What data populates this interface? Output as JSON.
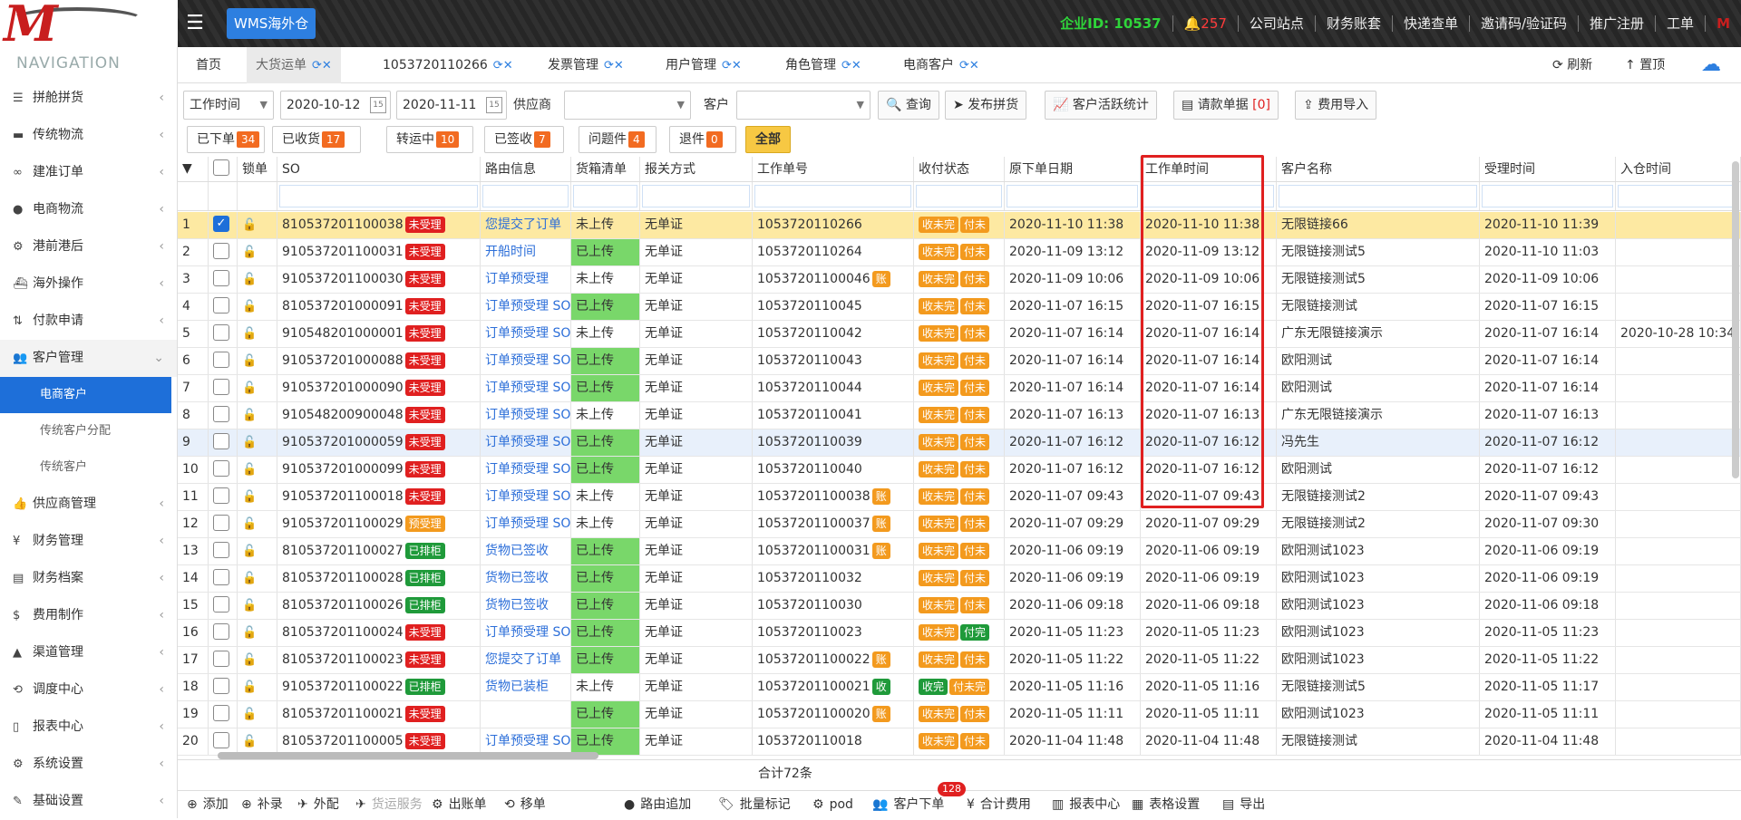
{
  "app": {
    "wms_button": "WMS海外仓",
    "nav_title": "NAVIGATION"
  },
  "top": {
    "ent_id": "企业ID:  10537",
    "bell_count": "257",
    "links": [
      "公司站点",
      "财务账套",
      "快递查单",
      "邀请码/验证码",
      "推广注册",
      "工单"
    ]
  },
  "sidebar": {
    "items": [
      {
        "label": "拼舱拼货",
        "icon": "list-icon"
      },
      {
        "label": "传统物流",
        "icon": "truck-icon"
      },
      {
        "label": "建准订单",
        "icon": "link-icon"
      },
      {
        "label": "电商物流",
        "icon": "globe-icon"
      },
      {
        "label": "港前港后",
        "icon": "gears-icon"
      },
      {
        "label": "海外操作",
        "icon": "ship-icon"
      },
      {
        "label": "付款申请",
        "icon": "sort-icon"
      },
      {
        "label": "客户管理",
        "icon": "users-icon"
      }
    ],
    "sub": [
      "电商客户",
      "传统客户分配",
      "传统客户"
    ],
    "items2": [
      {
        "label": "供应商管理",
        "icon": "thumb-icon"
      },
      {
        "label": "财务管理",
        "icon": "yen-icon"
      },
      {
        "label": "财务档案",
        "icon": "book-icon"
      },
      {
        "label": "费用制作",
        "icon": "dollar-icon"
      },
      {
        "label": "渠道管理",
        "icon": "road-icon"
      },
      {
        "label": "调度中心",
        "icon": "retweet-icon"
      },
      {
        "label": "报表中心",
        "icon": "file-icon"
      },
      {
        "label": "系统设置",
        "icon": "gear-icon"
      },
      {
        "label": "基础设置",
        "icon": "pencil-icon"
      }
    ]
  },
  "tabs": [
    {
      "label": "首页"
    },
    {
      "label": "大货运单"
    },
    {
      "label": "1053720110266"
    },
    {
      "label": "发票管理"
    },
    {
      "label": "用户管理"
    },
    {
      "label": "角色管理"
    },
    {
      "label": "电商客户"
    }
  ],
  "tab_actions": {
    "refresh": "刷新",
    "top": "置顶"
  },
  "filters": {
    "time_type": "工作时间",
    "date_from": "2020-10-12",
    "date_to": "2020-11-11",
    "supplier_label": "供应商",
    "customer_label": "客户",
    "query": "查询",
    "publish": "发布拼货",
    "stats": "客户活跃统计",
    "invoice": "请款单据",
    "invoice_count": "[0]",
    "fee_import": "费用导入"
  },
  "status_buttons": [
    {
      "label": "已下单",
      "count": "34"
    },
    {
      "label": "已收货",
      "count": "17"
    },
    {
      "label": "转运中",
      "count": "10"
    },
    {
      "label": "已签收",
      "count": "7"
    },
    {
      "label": "问题件",
      "count": "4"
    },
    {
      "label": "退件",
      "count": "0"
    }
  ],
  "status_all": "全部",
  "columns": [
    "锁单",
    "SO",
    "路由信息",
    "货箱清单",
    "报关方式",
    "工作单号",
    "收付状态",
    "原下单日期",
    "工作单时间",
    "客户名称",
    "受理时间",
    "入仓时间"
  ],
  "rows": [
    {
      "n": "1",
      "so": "810537201100038",
      "tag": "未受理",
      "tagc": "red",
      "route": "您提交了订单",
      "list": "未上传",
      "decl": "无单证",
      "wo": "1053720110266",
      "wotag": "",
      "pay": [
        "收未完",
        "付未"
      ],
      "orig": "2020-11-10 11:38",
      "wt": "2020-11-10 11:38",
      "cust": "无限链接66",
      "acc": "2020-11-10 11:39",
      "wh": ""
    },
    {
      "n": "2",
      "so": "910537201100031",
      "tag": "未受理",
      "tagc": "red",
      "route": "开船时间",
      "list": "已上传",
      "decl": "无单证",
      "wo": "1053720110264",
      "wotag": "",
      "pay": [
        "收未完",
        "付未"
      ],
      "orig": "2020-11-09 13:12",
      "wt": "2020-11-09 13:12",
      "cust": "无限链接测试5",
      "acc": "2020-11-10 11:03",
      "wh": ""
    },
    {
      "n": "3",
      "so": "910537201100030",
      "tag": "未受理",
      "tagc": "red",
      "route": "订单预受理",
      "list": "未上传",
      "decl": "无单证",
      "wo": "10537201100046",
      "wotag": "账",
      "pay": [
        "收未完",
        "付未"
      ],
      "orig": "2020-11-09 10:06",
      "wt": "2020-11-09 10:06",
      "cust": "无限链接测试5",
      "acc": "2020-11-09 10:06",
      "wh": ""
    },
    {
      "n": "4",
      "so": "810537201000091",
      "tag": "未受理",
      "tagc": "red",
      "route": "订单预受理 SO",
      "list": "已上传",
      "decl": "无单证",
      "wo": "1053720110045",
      "wotag": "",
      "pay": [
        "收未完",
        "付未"
      ],
      "orig": "2020-11-07 16:15",
      "wt": "2020-11-07 16:15",
      "cust": "无限链接测试",
      "acc": "2020-11-07 16:15",
      "wh": ""
    },
    {
      "n": "5",
      "so": "910548201000001",
      "tag": "未受理",
      "tagc": "red",
      "route": "订单预受理 SO",
      "list": "未上传",
      "decl": "无单证",
      "wo": "1053720110042",
      "wotag": "",
      "pay": [
        "收未完",
        "付未"
      ],
      "orig": "2020-11-07 16:14",
      "wt": "2020-11-07 16:14",
      "cust": "广东无限链接演示",
      "acc": "2020-11-07 16:14",
      "wh": "2020-10-28 10:34"
    },
    {
      "n": "6",
      "so": "910537201000088",
      "tag": "未受理",
      "tagc": "red",
      "route": "订单预受理 SO",
      "list": "已上传",
      "decl": "无单证",
      "wo": "1053720110043",
      "wotag": "",
      "pay": [
        "收未完",
        "付未"
      ],
      "orig": "2020-11-07 16:14",
      "wt": "2020-11-07 16:14",
      "cust": "欧阳测试",
      "acc": "2020-11-07 16:14",
      "wh": ""
    },
    {
      "n": "7",
      "so": "910537201000090",
      "tag": "未受理",
      "tagc": "red",
      "route": "订单预受理 SO",
      "list": "已上传",
      "decl": "无单证",
      "wo": "1053720110044",
      "wotag": "",
      "pay": [
        "收未完",
        "付未"
      ],
      "orig": "2020-11-07 16:14",
      "wt": "2020-11-07 16:14",
      "cust": "欧阳测试",
      "acc": "2020-11-07 16:14",
      "wh": ""
    },
    {
      "n": "8",
      "so": "910548200900048",
      "tag": "未受理",
      "tagc": "red",
      "route": "订单预受理 SO",
      "list": "未上传",
      "decl": "无单证",
      "wo": "1053720110041",
      "wotag": "",
      "pay": [
        "收未完",
        "付未"
      ],
      "orig": "2020-11-07 16:13",
      "wt": "2020-11-07 16:13",
      "cust": "广东无限链接演示",
      "acc": "2020-11-07 16:13",
      "wh": ""
    },
    {
      "n": "9",
      "so": "910537201000059",
      "tag": "未受理",
      "tagc": "red",
      "route": "订单预受理 SO",
      "list": "已上传",
      "decl": "无单证",
      "wo": "1053720110039",
      "wotag": "",
      "pay": [
        "收未完",
        "付未"
      ],
      "orig": "2020-11-07 16:12",
      "wt": "2020-11-07 16:12",
      "cust": "冯先生",
      "acc": "2020-11-07 16:12",
      "wh": ""
    },
    {
      "n": "10",
      "so": "910537201000099",
      "tag": "未受理",
      "tagc": "red",
      "route": "订单预受理 SO",
      "list": "已上传",
      "decl": "无单证",
      "wo": "1053720110040",
      "wotag": "",
      "pay": [
        "收未完",
        "付未"
      ],
      "orig": "2020-11-07 16:12",
      "wt": "2020-11-07 16:12",
      "cust": "欧阳测试",
      "acc": "2020-11-07 16:12",
      "wh": ""
    },
    {
      "n": "11",
      "so": "910537201100018",
      "tag": "未受理",
      "tagc": "red",
      "route": "订单预受理 SO",
      "list": "未上传",
      "decl": "无单证",
      "wo": "10537201100038",
      "wotag": "账",
      "pay": [
        "收未完",
        "付未"
      ],
      "orig": "2020-11-07 09:43",
      "wt": "2020-11-07 09:43",
      "cust": "无限链接测试2",
      "acc": "2020-11-07 09:43",
      "wh": ""
    },
    {
      "n": "12",
      "so": "910537201100029",
      "tag": "预受理",
      "tagc": "orange",
      "route": "订单预受理 SO",
      "list": "未上传",
      "decl": "无单证",
      "wo": "10537201100037",
      "wotag": "账",
      "pay": [
        "收未完",
        "付未"
      ],
      "orig": "2020-11-07 09:29",
      "wt": "2020-11-07 09:29",
      "cust": "无限链接测试2",
      "acc": "2020-11-07 09:30",
      "wh": ""
    },
    {
      "n": "13",
      "so": "810537201100027",
      "tag": "已排柜",
      "tagc": "green",
      "route": "货物已签收",
      "list": "已上传",
      "decl": "无单证",
      "wo": "10537201100031",
      "wotag": "账",
      "pay": [
        "收未完",
        "付未"
      ],
      "orig": "2020-11-06 09:19",
      "wt": "2020-11-06 09:19",
      "cust": "欧阳测试1023",
      "acc": "2020-11-06 09:19",
      "wh": ""
    },
    {
      "n": "14",
      "so": "810537201100028",
      "tag": "已排柜",
      "tagc": "green",
      "route": "货物已签收",
      "list": "已上传",
      "decl": "无单证",
      "wo": "1053720110032",
      "wotag": "",
      "pay": [
        "收未完",
        "付未"
      ],
      "orig": "2020-11-06 09:19",
      "wt": "2020-11-06 09:19",
      "cust": "欧阳测试1023",
      "acc": "2020-11-06 09:19",
      "wh": ""
    },
    {
      "n": "15",
      "so": "810537201100026",
      "tag": "已排柜",
      "tagc": "green",
      "route": "货物已签收",
      "list": "已上传",
      "decl": "无单证",
      "wo": "1053720110030",
      "wotag": "",
      "pay": [
        "收未完",
        "付未"
      ],
      "orig": "2020-11-06 09:18",
      "wt": "2020-11-06 09:18",
      "cust": "欧阳测试1023",
      "acc": "2020-11-06 09:18",
      "wh": ""
    },
    {
      "n": "16",
      "so": "810537201100024",
      "tag": "未受理",
      "tagc": "red",
      "route": "订单预受理 SO",
      "list": "已上传",
      "decl": "无单证",
      "wo": "1053720110023",
      "wotag": "",
      "pay": [
        "收未完",
        "付完"
      ],
      "orig": "2020-11-05 11:23",
      "wt": "2020-11-05 11:23",
      "cust": "欧阳测试1023",
      "acc": "2020-11-05 11:23",
      "wh": ""
    },
    {
      "n": "17",
      "so": "810537201100023",
      "tag": "未受理",
      "tagc": "red",
      "route": "您提交了订单",
      "list": "已上传",
      "decl": "无单证",
      "wo": "10537201100022",
      "wotag": "账",
      "pay": [
        "收未完",
        "付未"
      ],
      "orig": "2020-11-05 11:22",
      "wt": "2020-11-05 11:22",
      "cust": "欧阳测试1023",
      "acc": "2020-11-05 11:22",
      "wh": ""
    },
    {
      "n": "18",
      "so": "910537201100022",
      "tag": "已排柜",
      "tagc": "green",
      "route": "货物已装柜",
      "list": "未上传",
      "decl": "无单证",
      "wo": "10537201100021",
      "wotag": "收",
      "pay": [
        "收完",
        "付未完"
      ],
      "orig": "2020-11-05 11:16",
      "wt": "2020-11-05 11:16",
      "cust": "无限链接测试5",
      "acc": "2020-11-05 11:17",
      "wh": ""
    },
    {
      "n": "19",
      "so": "810537201100021",
      "tag": "未受理",
      "tagc": "red",
      "route": "",
      "list": "已上传",
      "decl": "无单证",
      "wo": "10537201100020",
      "wotag": "账",
      "pay": [
        "收未完",
        "付未"
      ],
      "orig": "2020-11-05 11:11",
      "wt": "2020-11-05 11:11",
      "cust": "欧阳测试1023",
      "acc": "2020-11-05 11:11",
      "wh": ""
    },
    {
      "n": "20",
      "so": "810537201100005",
      "tag": "未受理",
      "tagc": "red",
      "route": "订单预受理 SO",
      "list": "已上传",
      "decl": "无单证",
      "wo": "1053720110018",
      "wotag": "",
      "pay": [
        "收未完",
        "付未"
      ],
      "orig": "2020-11-04 11:48",
      "wt": "2020-11-04 11:48",
      "cust": "无限链接测试",
      "acc": "2020-11-04 11:48",
      "wh": ""
    }
  ],
  "summary": "合计72条",
  "bottom": {
    "actions": [
      "添加",
      "补录",
      "外配",
      "货运服务",
      "出账单",
      "移单",
      "路由追加",
      "批量标记",
      "pod",
      "客户下单",
      "合计费用",
      "报表中心",
      "表格设置",
      "导出"
    ],
    "badge": "128"
  },
  "colors": {
    "accent": "#1e6fd9",
    "highlight_box": "#e02020",
    "selected_row": "#fde9a2"
  }
}
